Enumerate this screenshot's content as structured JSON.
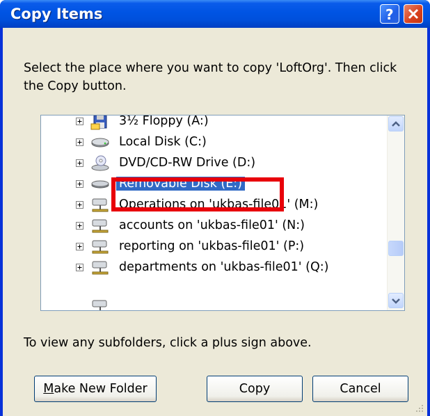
{
  "window": {
    "title": "Copy Items",
    "help_button": "?",
    "close_button": "✕"
  },
  "instructions": "Select the place where you want to copy 'LoftOrg'. Then click the Copy button.",
  "tree": {
    "items": [
      {
        "label": "3½ Floppy (A:)",
        "icon": "floppy-icon",
        "selected": false
      },
      {
        "label": "Local Disk (C:)",
        "icon": "hard-disk-icon",
        "selected": false
      },
      {
        "label": "DVD/CD-RW Drive (D:)",
        "icon": "cd-drive-icon",
        "selected": false
      },
      {
        "label": "Removable Disk (E:)",
        "icon": "removable-disk-icon",
        "selected": true
      },
      {
        "label": "Operations on 'ukbas-file01' (M:)",
        "icon": "network-drive-icon",
        "selected": false
      },
      {
        "label": "accounts on 'ukbas-file01' (N:)",
        "icon": "network-drive-icon",
        "selected": false
      },
      {
        "label": "reporting on 'ukbas-file01' (P:)",
        "icon": "network-drive-icon",
        "selected": false
      },
      {
        "label": "departments on 'ukbas-file01' (Q:)",
        "icon": "network-drive-icon",
        "selected": false
      }
    ]
  },
  "hint": "To view any subfolders, click a plus sign above.",
  "buttons": {
    "make_new_folder": {
      "mnemonic": "M",
      "rest": "ake New Folder"
    },
    "copy": "Copy",
    "cancel": "Cancel"
  },
  "colors": {
    "selection": "#316ac5",
    "highlight_box": "#e8000a",
    "titlebar": "#0054e3"
  }
}
